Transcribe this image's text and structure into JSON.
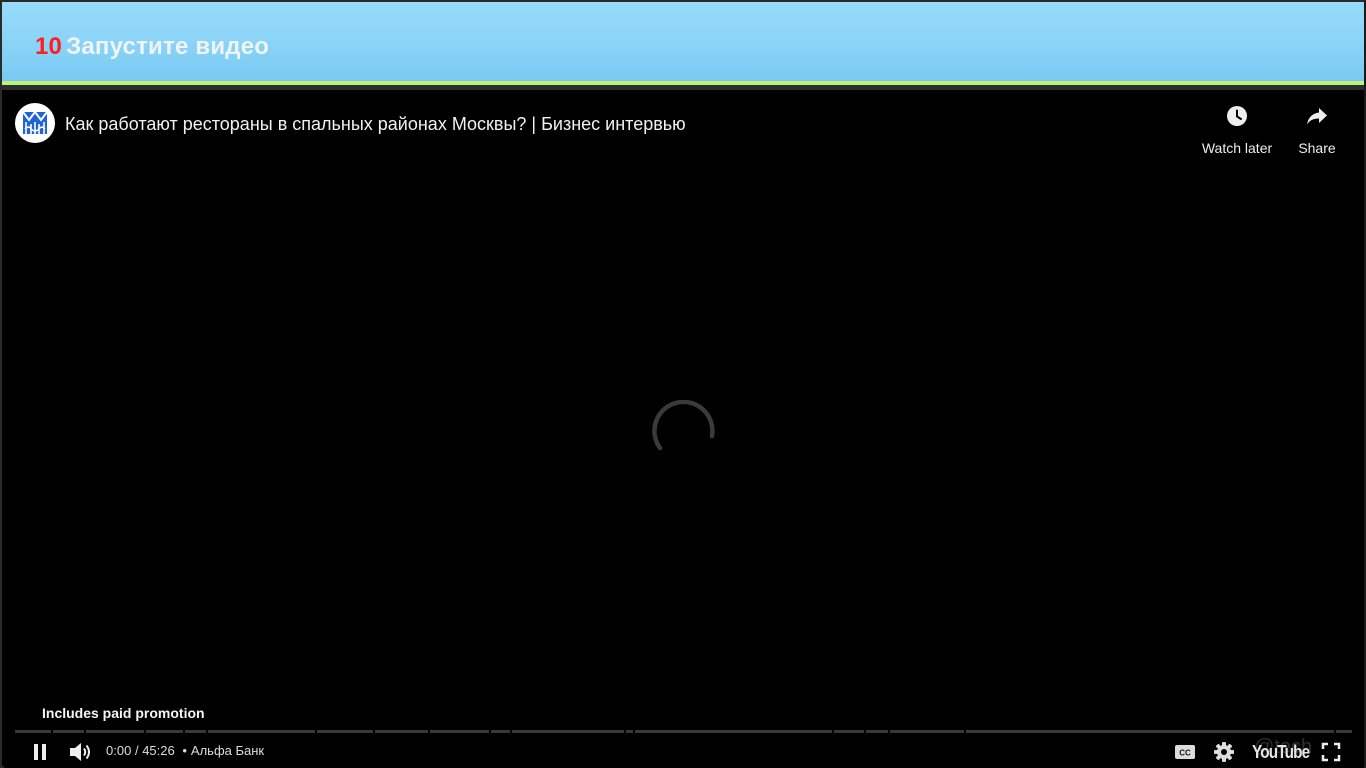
{
  "header": {
    "step_number": "10",
    "step_text": "Запустите видео",
    "accent_color": "#ff1e1e",
    "bar_color": "#8ad3f7"
  },
  "player": {
    "title": "Как работают рестораны в спальных районах Москвы? | Бизнес интервью",
    "watch_later_label": "Watch later",
    "share_label": "Share",
    "paid_promotion": "Includes paid promotion",
    "time_current": "0:00",
    "time_separator": "/",
    "time_total": "45:26",
    "chapter_separator": "•",
    "chapter_title": "Альфа Банк",
    "brand": "YouTube",
    "watermark": "@tech",
    "state": "loading",
    "progress": 0,
    "icons": {
      "avatar": "channel-logo",
      "watch_later": "clock-icon",
      "share": "share-arrow-icon",
      "play_pause": "pause-icon",
      "volume": "volume-icon",
      "captions": "cc-icon",
      "settings": "gear-icon",
      "fullscreen": "fullscreen-icon"
    }
  }
}
